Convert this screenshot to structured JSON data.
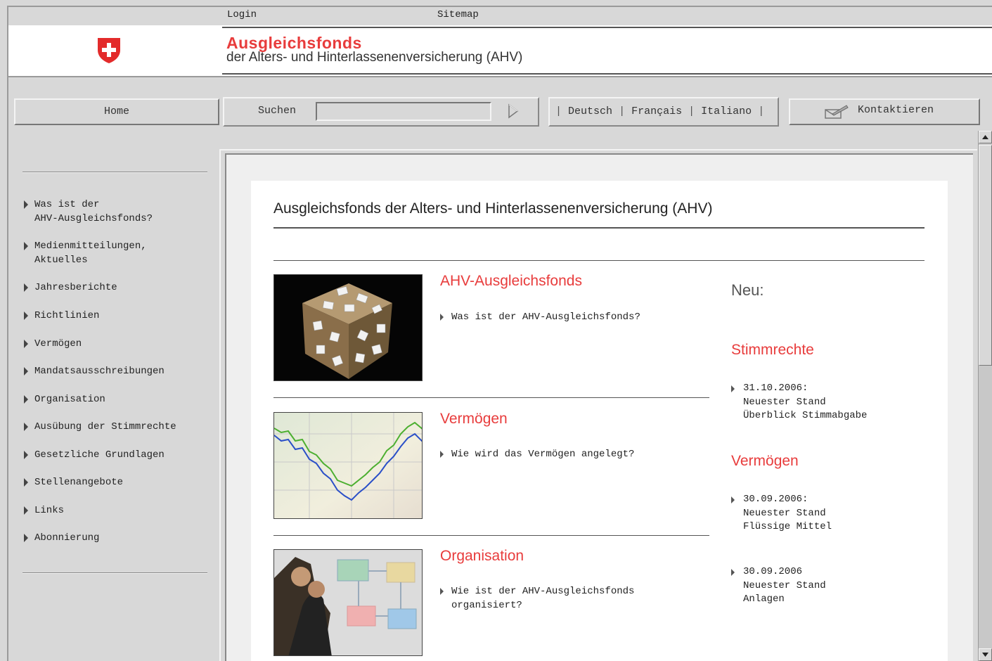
{
  "utilbar": {
    "login": "Login",
    "sitemap": "Sitemap"
  },
  "header": {
    "title": "Ausgleichsfonds",
    "subtitle": "der Alters- und Hinterlassenenversicherung (AHV)",
    "accent_color": "#e83c3c"
  },
  "nav": {
    "home": "Home",
    "search_label": "Suchen",
    "search_value": "",
    "languages": [
      "Deutsch",
      "Français",
      "Italiano"
    ],
    "contact": "Kontaktieren"
  },
  "sidebar": {
    "items": [
      {
        "line1": "Was ist der",
        "line2": "AHV-Ausgleichsfonds?"
      },
      {
        "line1": "Medienmitteilungen,",
        "line2": "Aktuelles"
      },
      {
        "line1": "Jahresberichte",
        "line2": ""
      },
      {
        "line1": "Richtlinien",
        "line2": ""
      },
      {
        "line1": "Vermögen",
        "line2": ""
      },
      {
        "line1": "Mandatsausschreibungen",
        "line2": ""
      },
      {
        "line1": "Organisation",
        "line2": ""
      },
      {
        "line1": "Ausübung der Stimmrechte",
        "line2": ""
      },
      {
        "line1": "Gesetzliche Grundlagen",
        "line2": ""
      },
      {
        "line1": "Stellenangebote",
        "line2": ""
      },
      {
        "line1": "Links",
        "line2": ""
      },
      {
        "line1": "Abonnierung",
        "line2": ""
      }
    ]
  },
  "main": {
    "page_title": "Ausgleichsfonds der Alters- und Hinterlassenenversicherung (AHV)",
    "sections": [
      {
        "title": "AHV-Ausgleichsfonds",
        "link1": "Was ist der AHV-Ausgleichsfonds?",
        "link2": "",
        "image": "dice-question-image"
      },
      {
        "title": "Vermögen",
        "link1": "Wie wird das Vermögen angelegt?",
        "link2": "",
        "image": "stock-chart-image"
      },
      {
        "title": "Organisation",
        "link1": "Wie ist der AHV-Ausgleichsfonds",
        "link2": "organisiert?",
        "image": "meeting-image"
      }
    ]
  },
  "right": {
    "neu": "Neu:",
    "groups": [
      {
        "title": "Stimmrechte",
        "news": [
          {
            "l1": "31.10.2006:",
            "l2": "Neuester Stand",
            "l3": "Überblick Stimmabgabe"
          }
        ]
      },
      {
        "title": "Vermögen",
        "news": [
          {
            "l1": "30.09.2006:",
            "l2": "Neuester Stand",
            "l3": "Flüssige Mittel"
          },
          {
            "l1": "30.09.2006",
            "l2": "Neuester Stand",
            "l3": "Anlagen"
          }
        ]
      }
    ]
  }
}
